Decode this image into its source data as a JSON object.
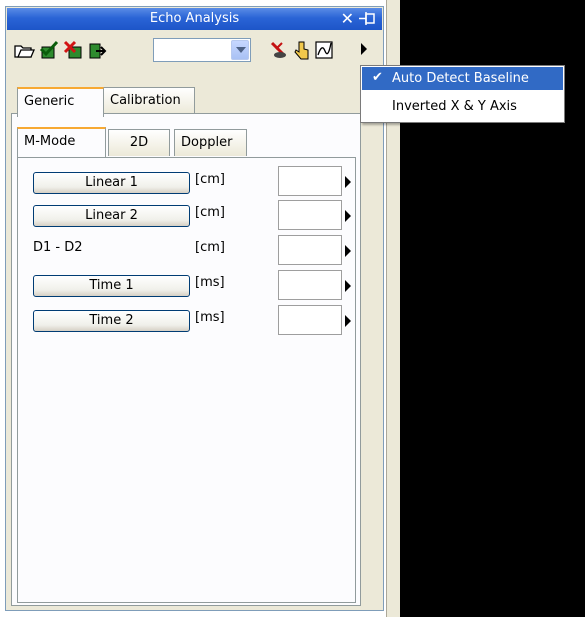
{
  "window": {
    "title": "Echo Analysis"
  },
  "toolbar": {
    "icons": [
      "open-folder-icon",
      "check-save-icon",
      "delete-icon",
      "export-icon",
      "measure-icon",
      "hand-pointer-icon",
      "curve-chart-icon"
    ],
    "profile_value": ""
  },
  "tabs_outer": [
    {
      "label": "Generic",
      "active": true
    },
    {
      "label": "Calibration",
      "active": false
    }
  ],
  "tabs_inner": [
    {
      "label": "M-Mode",
      "active": true
    },
    {
      "label": "2D",
      "active": false
    },
    {
      "label": "Doppler",
      "active": false
    }
  ],
  "rows": [
    {
      "label": "Linear 1",
      "unit": "[cm]",
      "button": true,
      "value": ""
    },
    {
      "label": "Linear 2",
      "unit": "[cm]",
      "button": true,
      "value": ""
    },
    {
      "label": "D1 - D2",
      "unit": "[cm]",
      "button": false,
      "value": ""
    },
    {
      "label": "Time 1",
      "unit": "[ms]",
      "button": true,
      "value": ""
    },
    {
      "label": "Time 2",
      "unit": "[ms]",
      "button": true,
      "value": ""
    }
  ],
  "menu": {
    "items": [
      {
        "label": "Auto Detect Baseline",
        "checked": true
      },
      {
        "label": "Inverted X & Y Axis",
        "checked": false
      }
    ]
  },
  "colors": {
    "titlebar": "#2a64d6",
    "menu_highlight": "#316ac5",
    "tab_accent": "#f7a933"
  }
}
